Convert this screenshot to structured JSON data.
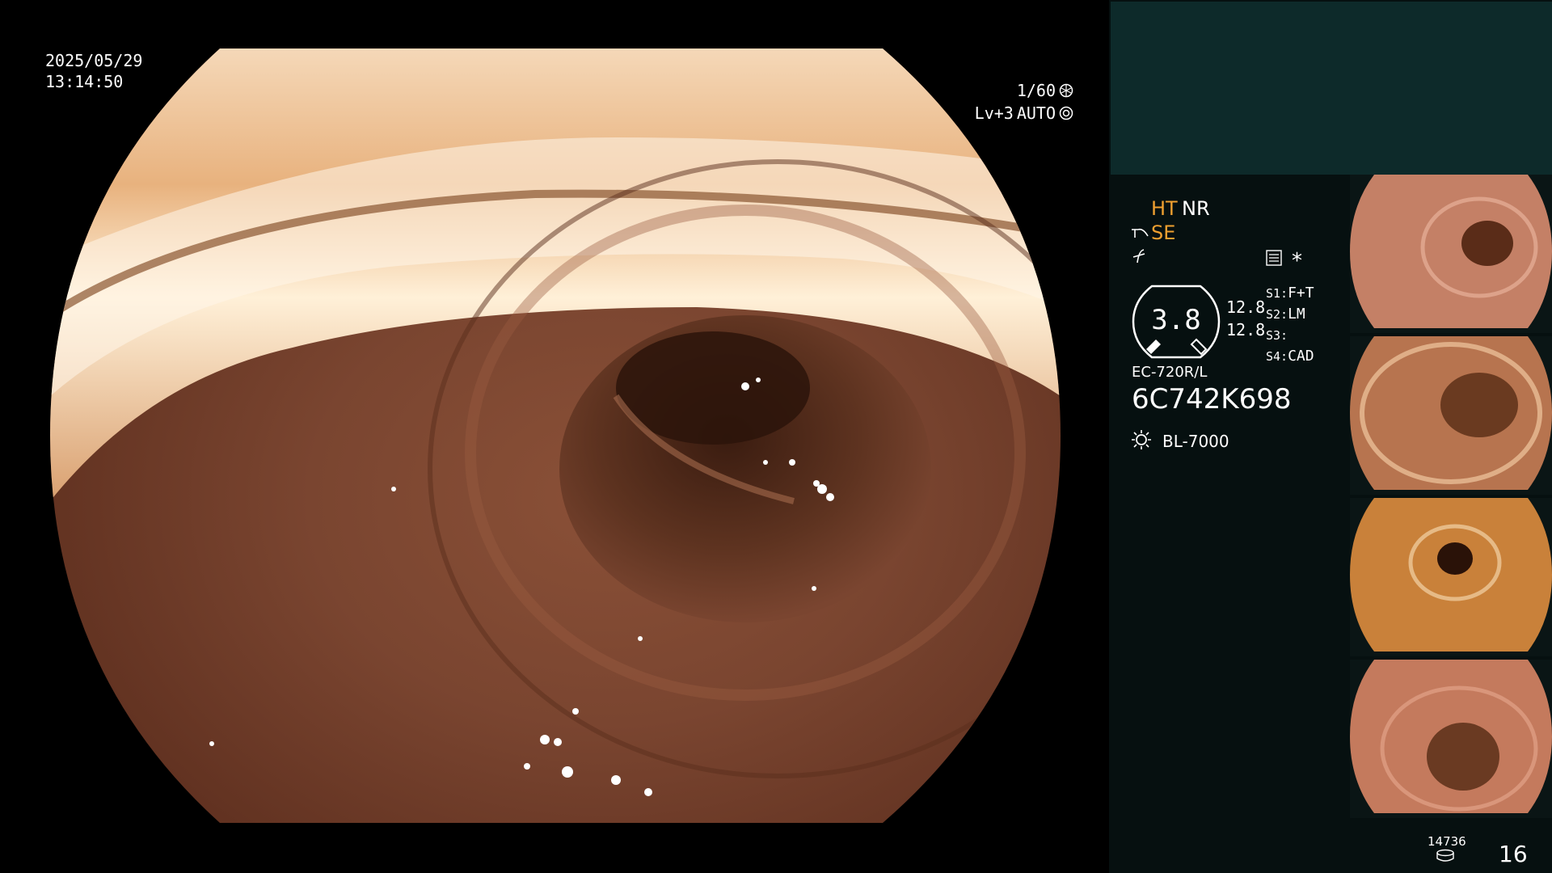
{
  "osd": {
    "date": "2025/05/29",
    "time": "13:14:50",
    "shutter": "1/60",
    "iris_level": "Lv+3",
    "iris_mode": "AUTO"
  },
  "settings": {
    "ht": "HT",
    "nr": "NR",
    "se": "SE",
    "star": "*"
  },
  "zoom": {
    "value": "3.8",
    "val1": "12.8",
    "val2": "12.8"
  },
  "switches": [
    {
      "key": "S1:",
      "value": "F+T"
    },
    {
      "key": "S2:",
      "value": "LM"
    },
    {
      "key": "S3:",
      "value": ""
    },
    {
      "key": "S4:",
      "value": "CAD"
    }
  ],
  "scope": {
    "model": "EC-720R/L",
    "serial": "6C742K698"
  },
  "light_source": "BL-7000",
  "footer": {
    "image_count": "14736",
    "capture_count": "16"
  },
  "colors": {
    "accent_orange": "#f0a030",
    "panel_bg": "#061010",
    "panel_top": "#0d2a2a"
  },
  "thumbnails": [
    {
      "name": "thumbnail-1",
      "tone": "#c48066"
    },
    {
      "name": "thumbnail-2",
      "tone": "#b7744f"
    },
    {
      "name": "thumbnail-3",
      "tone": "#c9813a"
    },
    {
      "name": "thumbnail-4",
      "tone": "#c47a5d"
    }
  ]
}
